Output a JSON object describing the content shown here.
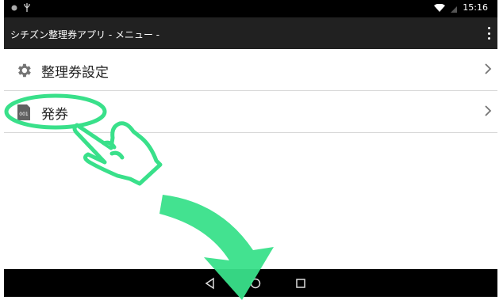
{
  "status_bar": {
    "time": "15:16",
    "left_icons": [
      "notification-dot-icon",
      "usb-icon"
    ],
    "right_icons": [
      "wifi-icon",
      "battery-icon"
    ]
  },
  "app_bar": {
    "title": "シチズン整理券アプリ - メニュー -"
  },
  "menu": [
    {
      "label": "整理券設定",
      "icon": "gear-icon"
    },
    {
      "label": "発券",
      "icon": "ticket-icon",
      "icon_text": "001"
    }
  ],
  "nav_bar": {
    "buttons": [
      "back-icon",
      "home-icon",
      "recents-icon"
    ]
  },
  "annotation": {
    "color": "#39e08a",
    "highlight_target": "発券"
  }
}
